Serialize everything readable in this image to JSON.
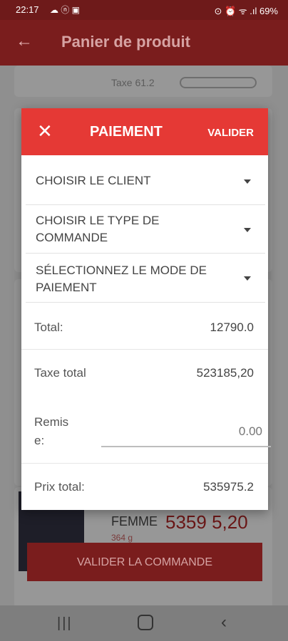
{
  "status_bar": {
    "time": "22:17",
    "left_icons": "☁ ⓝ ▣",
    "right_text": "⊙ ⏰ ᯤ .ıl 69%"
  },
  "appbar": {
    "title": "Panier de produit"
  },
  "background": {
    "taxe_text": "Taxe  61.2",
    "product_label": "FEMME",
    "product_price": "5359 5,20",
    "product_sub": "364 g",
    "validate_order_label": "VALIDER LA COMMANDE"
  },
  "dialog": {
    "title": "PAIEMENT",
    "validate_label": "VALIDER",
    "client_select": "CHOISIR LE CLIENT",
    "order_type_select": "CHOISIR LE TYPE DE COMMANDE",
    "payment_mode_select": "SÉLECTIONNEZ LE MODE DE PAIEMENT",
    "total_label": "Total:",
    "total_value": "12790.0",
    "tax_total_label": "Taxe total",
    "tax_total_value": "523185,20",
    "discount_label": "Remis\ne:",
    "discount_placeholder": "0.00",
    "grand_total_label": "Prix total:",
    "grand_total_value": "535975.2"
  },
  "icons": {
    "back": "arrow-left-icon",
    "close": "close-icon",
    "caret": "caret-down-icon"
  }
}
